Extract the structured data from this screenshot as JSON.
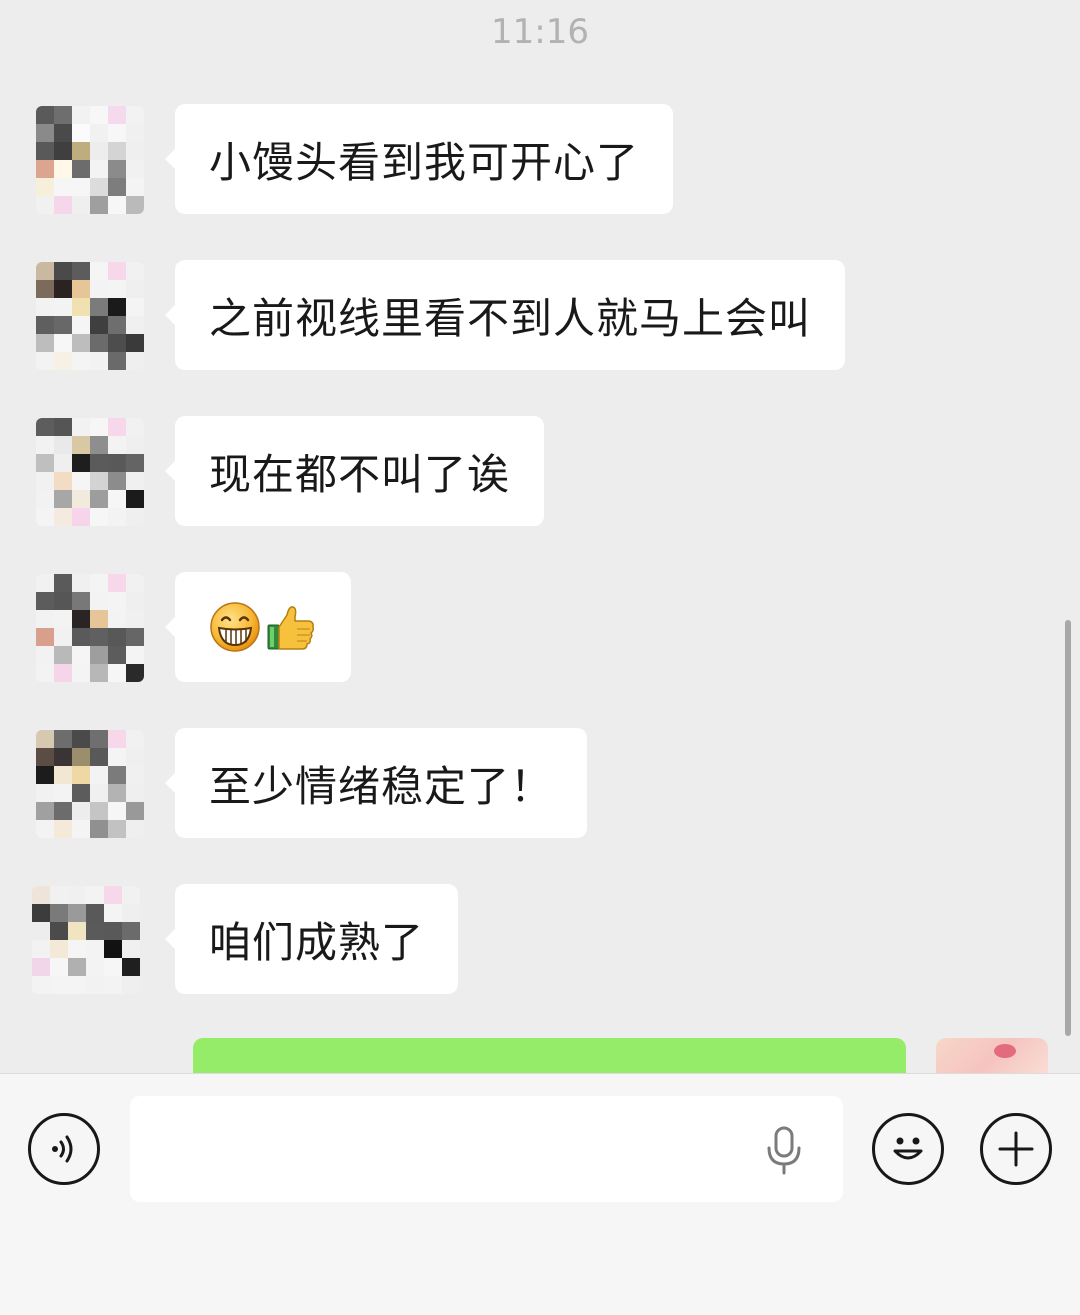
{
  "timestamp": "11:16",
  "messages": [
    {
      "type": "text",
      "text": "小馒头看到我可开心了"
    },
    {
      "type": "text",
      "text": "之前视线里看不到人就马上会叫"
    },
    {
      "type": "text",
      "text": "现在都不叫了诶"
    },
    {
      "type": "emoji",
      "emojis": [
        "grin-icon",
        "thumbs-up-icon"
      ]
    },
    {
      "type": "text",
      "text": "至少情绪稳定了！"
    },
    {
      "type": "text",
      "text": "咱们成熟了"
    }
  ],
  "input": {
    "value": "",
    "placeholder": ""
  },
  "colors": {
    "chat_background": "#ededed",
    "incoming_bubble": "#ffffff",
    "outgoing_bubble": "#95ec69",
    "input_bar": "#f6f6f6",
    "timestamp_text": "#b2b2b2"
  },
  "icons": {
    "voice": "voice-icon",
    "mic": "microphone-icon",
    "emoji": "emoji-face-icon",
    "plus": "plus-icon"
  }
}
